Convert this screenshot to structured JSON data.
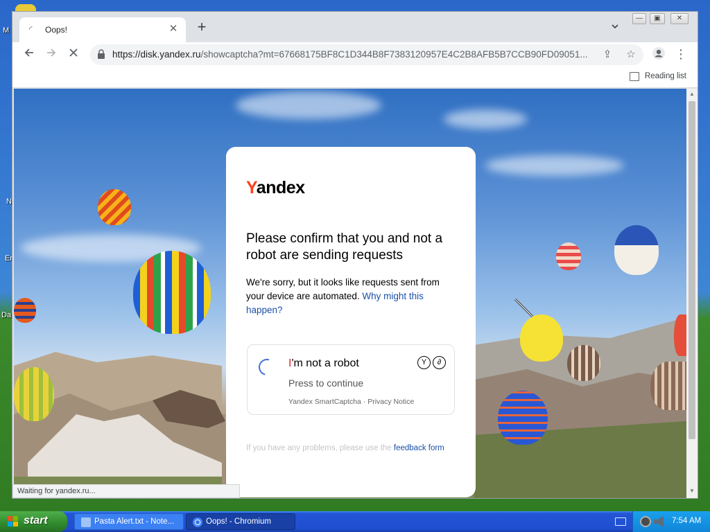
{
  "desktop": {
    "labels": [
      "M",
      "N",
      "Er",
      "Da"
    ]
  },
  "browser": {
    "tab_title": "Oops!",
    "tab_close": "✕",
    "new_tab": "+",
    "url_host": "https://disk.yandex.ru",
    "url_path": "/showcaptcha?mt=67668175BF8C1D344B8F7383120957E4C2B8AFB5B7CCB90FD09051...",
    "reading_list": "Reading list",
    "status_text": "Waiting for yandex.ru..."
  },
  "captcha_page": {
    "logo_y": "Y",
    "logo_rest": "andex",
    "heading": "Please confirm that you and not a robot are sending requests",
    "description": "We're sorry, but it looks like requests sent from your device are automated. ",
    "why_link": "Why might this happen?",
    "checkbox_title_i": "I",
    "checkbox_title_rest": "'m not a robot",
    "press_to_continue": "Press to continue",
    "captcha_footer": "Yandex SmartCaptcha · Privacy Notice",
    "feedback_text": "If you have any problems, please use the ",
    "feedback_link": "feedback form"
  },
  "taskbar": {
    "start_label": "start",
    "tasks": [
      {
        "label": "Pasta Alert.txt - Note..."
      },
      {
        "label": "Oops! - Chromium"
      }
    ],
    "clock": "7:54 AM"
  },
  "colors": {
    "yandex_red": "#fc3f1d",
    "link_blue": "#1a4fa8",
    "spinner_blue": "#4270d6"
  }
}
